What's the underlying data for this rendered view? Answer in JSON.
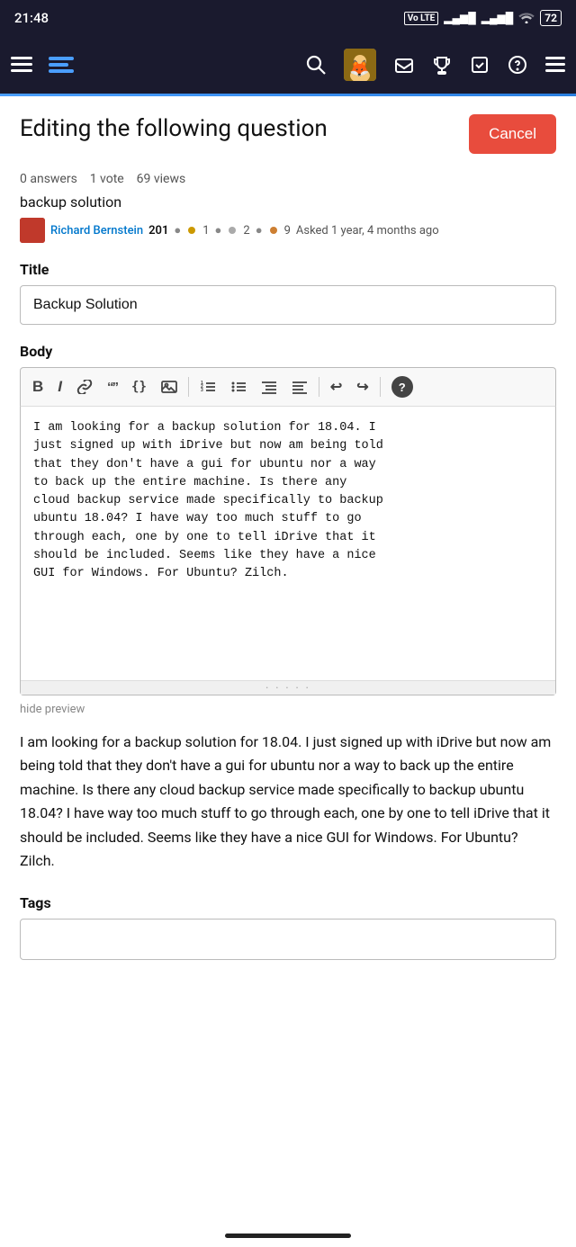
{
  "statusBar": {
    "time": "21:48",
    "batteryLevel": "72"
  },
  "navBar": {
    "menuIcon": "☰",
    "searchIcon": "🔍",
    "helpIcon": "?",
    "menuRightIcon": "≡"
  },
  "pageHeader": {
    "title": "Editing the following question",
    "cancelLabel": "Cancel"
  },
  "questionMeta": {
    "answers": "0 answers",
    "votes": "1 vote",
    "views": "69 views",
    "originalTitle": "backup solution",
    "authorName": "Richard Bernstein",
    "authorRep": "201",
    "badgeCounts": "1 • 2 • 9",
    "askedTime": "Asked 1 year, 4 months ago"
  },
  "form": {
    "titleLabel": "Title",
    "titleValue": "Backup Solution",
    "bodyLabel": "Body",
    "bodyContent": "I am looking for a backup solution for 18.04. I\njust signed up with iDrive but now am being told\nthat they don't have a gui for ubuntu nor a way\nto back up the entire machine. Is there any\ncloud backup service made specifically to backup\nubuntu 18.04? I have way too much stuff to go\nthrough each, one by one to tell iDrive that it\nshould be included. Seems like they have a nice\nGUI for Windows. For Ubuntu? Zilch.",
    "toolbar": {
      "bold": "B",
      "italic": "I",
      "link": "🔗",
      "blockquote": "\"\"",
      "code": "{}",
      "image": "🖼",
      "numberedList": "1≡",
      "bulletList": "≡",
      "headerLeft": "⊟",
      "headerRight": "—",
      "undo": "↩",
      "redo": "↪",
      "help": "?"
    },
    "hidePrevieLinkLabel": "hide preview",
    "previewText": "I am looking for a backup solution for 18.04. I just signed up with iDrive but now am being told that they don't have a gui for ubuntu nor a way to back up the entire machine. Is there any cloud backup service made specifically to backup ubuntu 18.04? I have way too much stuff to go through each, one by one to tell iDrive that it should be included. Seems like they have a nice GUI for Windows. For Ubuntu? Zilch.",
    "tagsLabel": "Tags"
  }
}
